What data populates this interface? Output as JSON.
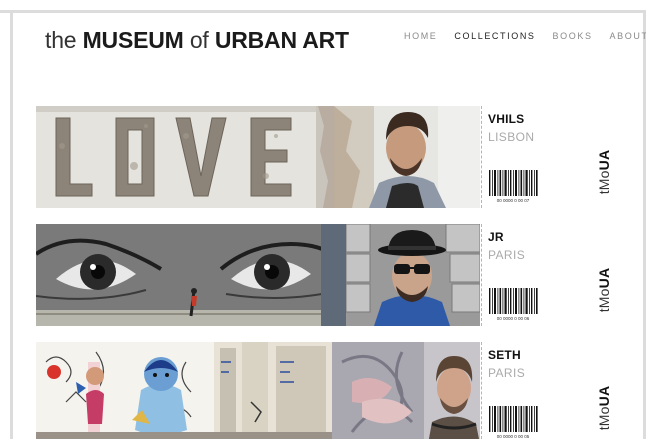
{
  "brand": {
    "the": "the",
    "museum": "MUSEUM",
    "of": "of",
    "urban_art": "URBAN ART"
  },
  "nav": {
    "items": [
      "HOME",
      "COLLECTIONS",
      "BOOKS",
      "ABOUT"
    ],
    "active": "COLLECTIONS"
  },
  "artists": [
    {
      "name": "VHILS",
      "city": "LISBON",
      "barcode_number": "00 0000 0 00 07",
      "stamp": {
        "prefix": "tMo",
        "bold": "UA"
      }
    },
    {
      "name": "JR",
      "city": "PARIS",
      "barcode_number": "00 0000 0 00 06",
      "stamp": {
        "prefix": "tMo",
        "bold": "UA"
      }
    },
    {
      "name": "SETH",
      "city": "PARIS",
      "barcode_number": "00 0000 0 00 05",
      "stamp": {
        "prefix": "tMo",
        "bold": "UA"
      }
    }
  ],
  "colors": {
    "frame": "#dcdcdc",
    "text_dark": "#111111",
    "text_light": "#aaaaaa",
    "nav_inactive": "#8a8a8a"
  }
}
